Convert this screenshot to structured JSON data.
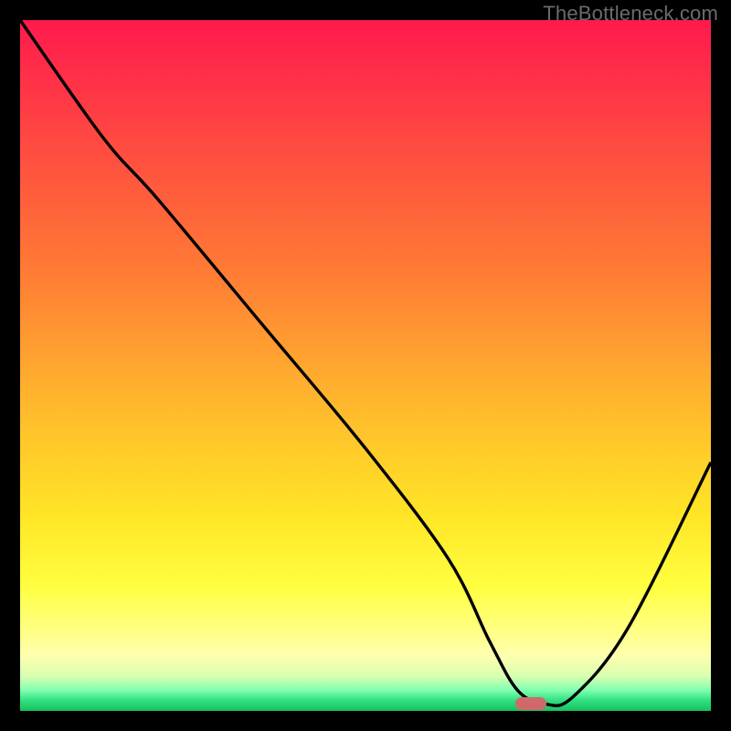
{
  "watermark": "TheBottleneck.com",
  "colors": {
    "curve_stroke": "#000000",
    "marker_fill": "#d06a6a",
    "background": "#000000"
  },
  "chart_data": {
    "type": "line",
    "title": "",
    "xlabel": "",
    "ylabel": "",
    "xlim": [
      0,
      100
    ],
    "ylim": [
      0,
      100
    ],
    "grid": false,
    "legend": false,
    "series": [
      {
        "name": "bottleneck-curve",
        "x": [
          0,
          12,
          20,
          35,
          50,
          62,
          68,
          72,
          76,
          80,
          88,
          100
        ],
        "y": [
          100,
          83,
          74,
          56,
          38,
          22,
          10,
          3,
          1,
          2,
          12,
          36
        ]
      }
    ],
    "marker": {
      "x": 74,
      "y": 1
    }
  }
}
